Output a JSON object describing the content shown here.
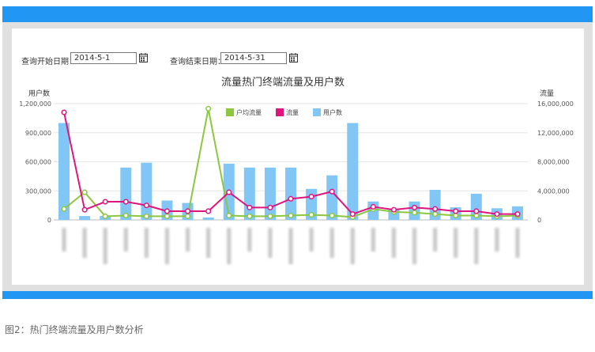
{
  "filters": {
    "start_label": "查询开始日期：",
    "start_value": "2014-5-1",
    "end_label": "查询结束日期：",
    "end_value": "2014-5-31"
  },
  "colors": {
    "bar": "#82c6f5",
    "line_avg": "#8dc63f",
    "line_flow": "#e0147f",
    "header": "#2196f3",
    "frame": "#e0e0e0"
  },
  "caption": "图2：热门终端流量及用户数分析",
  "chart_data": {
    "type": "bar",
    "title": "流量热门终端流量及用户数",
    "ylabel": "用户数",
    "y2label": "流量",
    "ylim": [
      0,
      1200000
    ],
    "y2lim": [
      0,
      16000000
    ],
    "yticks": [
      "1,200,000",
      "900,000",
      "600,000",
      "300,000",
      "0"
    ],
    "y2ticks": [
      "16,000,000",
      "12,000,000",
      "8,000,000",
      "4,000,000",
      "0"
    ],
    "grid": true,
    "legend": [
      "户均流量",
      "流量",
      "用户数"
    ],
    "legend_position": "top-center",
    "categories_blurred": true,
    "series": [
      {
        "name": "用户数",
        "kind": "bar",
        "axis": "left",
        "values": [
          1000000,
          40000,
          40000,
          540000,
          590000,
          200000,
          175000,
          25000,
          580000,
          540000,
          540000,
          540000,
          320000,
          460000,
          1000000,
          190000,
          110000,
          190000,
          310000,
          130000,
          270000,
          120000,
          140000
        ]
      },
      {
        "name": "流量",
        "kind": "line",
        "axis": "right",
        "values": [
          14800000,
          1400000,
          2500000,
          2500000,
          2000000,
          1200000,
          1200000,
          1200000,
          3800000,
          1700000,
          1700000,
          2900000,
          3200000,
          3900000,
          800000,
          1800000,
          1400000,
          1700000,
          1500000,
          1200000,
          1200000,
          800000,
          800000
        ]
      },
      {
        "name": "户均流量",
        "kind": "line",
        "axis": "right",
        "values": [
          1500000,
          3800000,
          500000,
          600000,
          500000,
          500000,
          500000,
          15300000,
          600000,
          500000,
          500000,
          600000,
          700000,
          600000,
          400000,
          1500000,
          1100000,
          1000000,
          800000,
          600000,
          600000,
          500000,
          600000
        ]
      }
    ]
  }
}
